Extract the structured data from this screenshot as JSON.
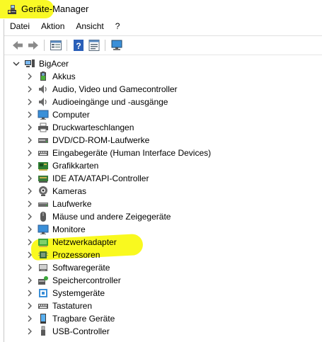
{
  "window": {
    "title": "Geräte-Manager"
  },
  "menubar": {
    "items": [
      "Datei",
      "Aktion",
      "Ansicht",
      "?"
    ]
  },
  "toolbar": {
    "buttons": [
      "back-icon",
      "forward-icon",
      "properties-icon",
      "help-icon",
      "monitor-icon"
    ]
  },
  "tree": {
    "root": {
      "label": "BigAcer",
      "icon": "computer-icon"
    },
    "items": [
      {
        "label": "Akkus",
        "icon": "battery-icon"
      },
      {
        "label": "Audio, Video und Gamecontroller",
        "icon": "speaker-icon"
      },
      {
        "label": "Audioeingänge und -ausgänge",
        "icon": "speaker-icon"
      },
      {
        "label": "Computer",
        "icon": "monitor-icon"
      },
      {
        "label": "Druckwarteschlangen",
        "icon": "printer-icon"
      },
      {
        "label": "DVD/CD-ROM-Laufwerke",
        "icon": "disc-drive-icon"
      },
      {
        "label": "Eingabegeräte (Human Interface Devices)",
        "icon": "keyboard-icon"
      },
      {
        "label": "Grafikkarten",
        "icon": "display-adapter-icon"
      },
      {
        "label": "IDE ATA/ATAPI-Controller",
        "icon": "controller-icon"
      },
      {
        "label": "Kameras",
        "icon": "camera-icon"
      },
      {
        "label": "Laufwerke",
        "icon": "drive-icon"
      },
      {
        "label": "Mäuse und andere Zeigegeräte",
        "icon": "mouse-icon"
      },
      {
        "label": "Monitore",
        "icon": "monitor-icon"
      },
      {
        "label": "Netzwerkadapter",
        "icon": "network-adapter-icon"
      },
      {
        "label": "Prozessoren",
        "icon": "chip-icon"
      },
      {
        "label": "Softwaregeräte",
        "icon": "software-icon"
      },
      {
        "label": "Speichercontroller",
        "icon": "storage-controller-icon"
      },
      {
        "label": "Systemgeräte",
        "icon": "system-icon"
      },
      {
        "label": "Tastaturen",
        "icon": "keyboard-icon"
      },
      {
        "label": "Tragbare Geräte",
        "icon": "portable-device-icon"
      },
      {
        "label": "USB-Controller",
        "icon": "usb-icon"
      }
    ]
  },
  "colors": {
    "highlight": "#f8f800",
    "icon_blue": "#3a8fd8",
    "icon_green": "#3aa63a"
  }
}
